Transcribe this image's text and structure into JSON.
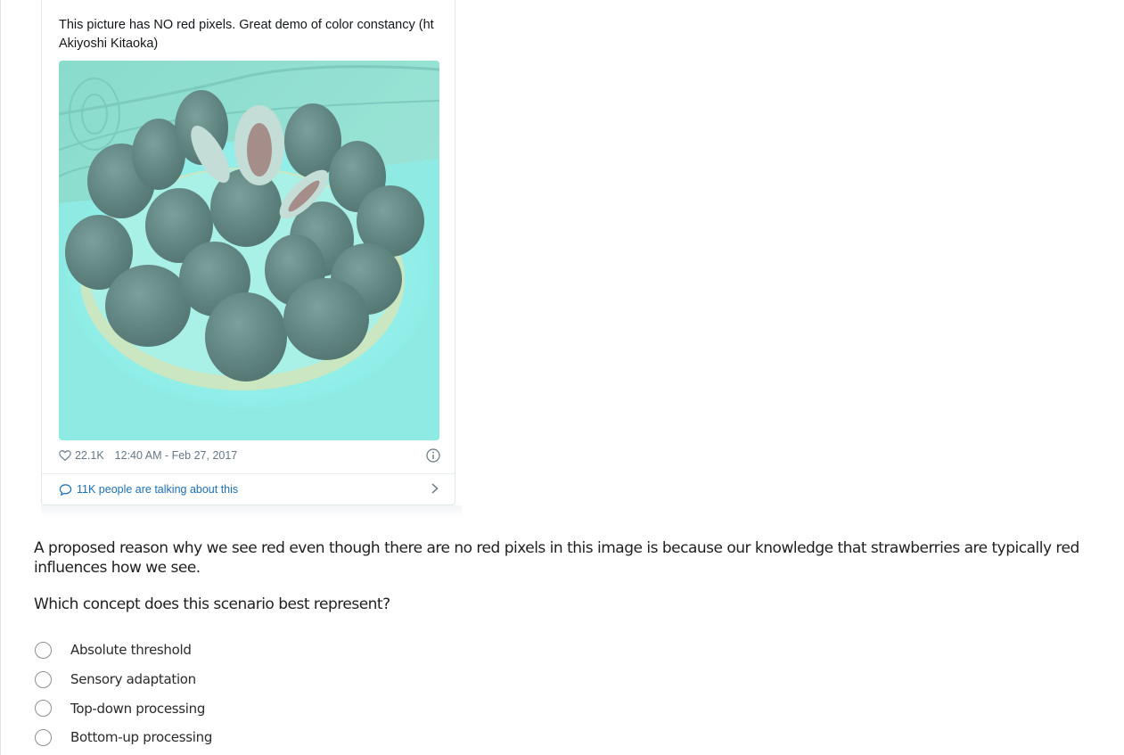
{
  "tweet": {
    "text": "This picture has NO red pixels.  Great demo of color constancy (ht Akiyoshi Kitaoka)",
    "likes": "22.1K",
    "timestamp": "12:40 AM - Feb 27, 2017",
    "talking": "11K people are talking about this",
    "icons": [
      "heart-icon",
      "info-icon",
      "speech-bubble-icon",
      "chevron-right-icon"
    ],
    "colors": {
      "text": "#14171a",
      "meta": "#657786",
      "link": "#1b6fb5",
      "photo_tint": "#7fe3dd"
    }
  },
  "question": {
    "body": "A proposed reason why we see red even though there are no red pixels in this image is because our knowledge that strawberries are typically red influences how we see.",
    "prompt": "Which concept does this scenario best represent?",
    "options": [
      {
        "label": "Absolute threshold",
        "selected": false
      },
      {
        "label": "Sensory adaptation",
        "selected": false
      },
      {
        "label": "Top-down processing",
        "selected": false
      },
      {
        "label": "Bottom-up processing",
        "selected": false
      }
    ]
  }
}
